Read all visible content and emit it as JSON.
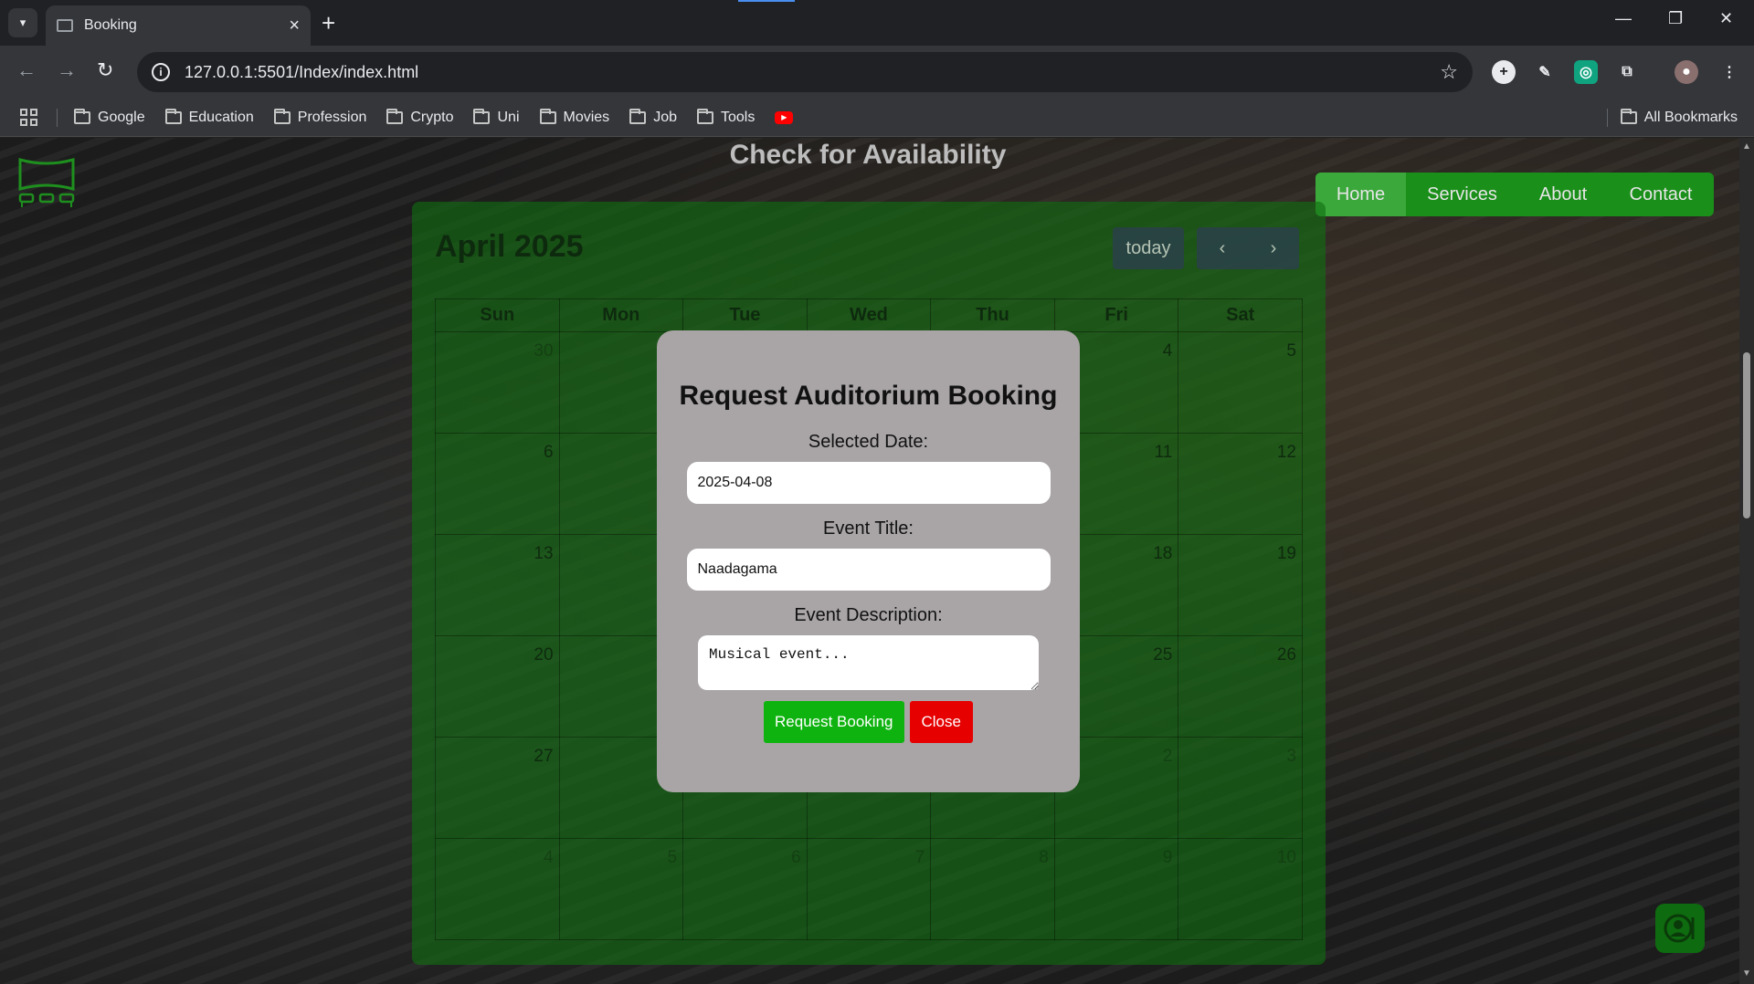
{
  "browser": {
    "tab_title": "Booking",
    "url": "127.0.0.1:5501/Index/index.html",
    "bookmarks": [
      "Google",
      "Education",
      "Profession",
      "Crypto",
      "Uni",
      "Movies",
      "Job",
      "Tools"
    ],
    "all_bookmarks_label": "All Bookmarks"
  },
  "page": {
    "heading": "Check for Availability",
    "nav": [
      "Home",
      "Services",
      "About",
      "Contact"
    ],
    "active_nav": "Home"
  },
  "calendar": {
    "title": "April 2025",
    "today_label": "today",
    "prev_label": "‹",
    "next_label": "›",
    "weekdays": [
      "Sun",
      "Mon",
      "Tue",
      "Wed",
      "Thu",
      "Fri",
      "Sat"
    ],
    "weeks": [
      [
        "30",
        "",
        "",
        "",
        "",
        "4",
        "5"
      ],
      [
        "6",
        "",
        "",
        "",
        "",
        "11",
        "12"
      ],
      [
        "13",
        "",
        "",
        "",
        "",
        "18",
        "19"
      ],
      [
        "20",
        "",
        "",
        "",
        "",
        "25",
        "26"
      ],
      [
        "27",
        "",
        "",
        "",
        "",
        "2",
        "3"
      ],
      [
        "4",
        "5",
        "6",
        "7",
        "8",
        "9",
        "10"
      ]
    ]
  },
  "modal": {
    "title": "Request Auditorium Booking",
    "date_label": "Selected Date:",
    "date_value": "2025-04-08",
    "event_title_label": "Event Title:",
    "event_title_value": "Naadagama",
    "event_desc_label": "Event Description:",
    "event_desc_value": "Musical event...",
    "request_label": "Request Booking",
    "close_label": "Close"
  }
}
